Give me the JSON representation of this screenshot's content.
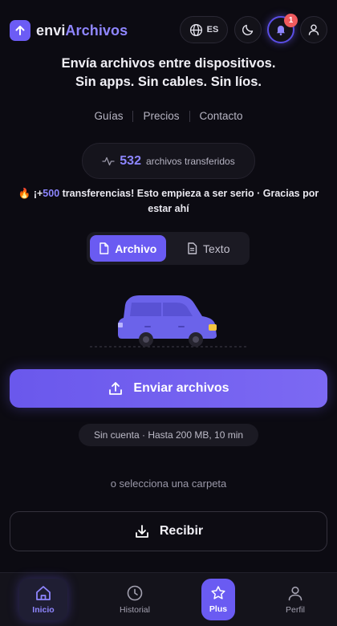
{
  "header": {
    "logo_prefix": "envi",
    "logo_suffix": "Archivos",
    "language": "ES",
    "notification_count": "1",
    "icons": [
      "arrow-up-icon",
      "globe-icon",
      "moon-icon",
      "bell-icon",
      "user-icon"
    ]
  },
  "hero": {
    "tagline_line1": "Envía archivos entre dispositivos.",
    "tagline_line2": "Sin apps. Sin cables. Sin líos."
  },
  "nav_links": [
    "Guías",
    "Precios",
    "Contacto"
  ],
  "stats": {
    "count": "532",
    "label": "archivos transferidos"
  },
  "milestone": {
    "emoji": "🔥",
    "prefix": "¡+",
    "number": "500",
    "text": " transferencias! Esto empieza a ser serio · Gracias por estar ahí"
  },
  "mode_toggle": {
    "options": [
      "Archivo",
      "Texto"
    ],
    "selected": "Archivo"
  },
  "actions": {
    "send_label": "Enviar archivos",
    "limit_text": "Sin cuenta · Hasta 200 MB, 10 min",
    "folder_link": "o selecciona una carpeta",
    "receive_label": "Recibir"
  },
  "bottom_nav": {
    "items": [
      {
        "label": "Inicio",
        "icon": "home-icon",
        "active": true
      },
      {
        "label": "Historial",
        "icon": "clock-icon",
        "active": false
      },
      {
        "label": "Plus",
        "icon": "star-icon",
        "active": false
      },
      {
        "label": "Perfil",
        "icon": "user-icon",
        "active": false
      }
    ]
  },
  "colors": {
    "background": "#0c0b12",
    "accent": "#6a5bf2",
    "accent_text": "#8d86ff",
    "badge": "#ef5a5e"
  }
}
